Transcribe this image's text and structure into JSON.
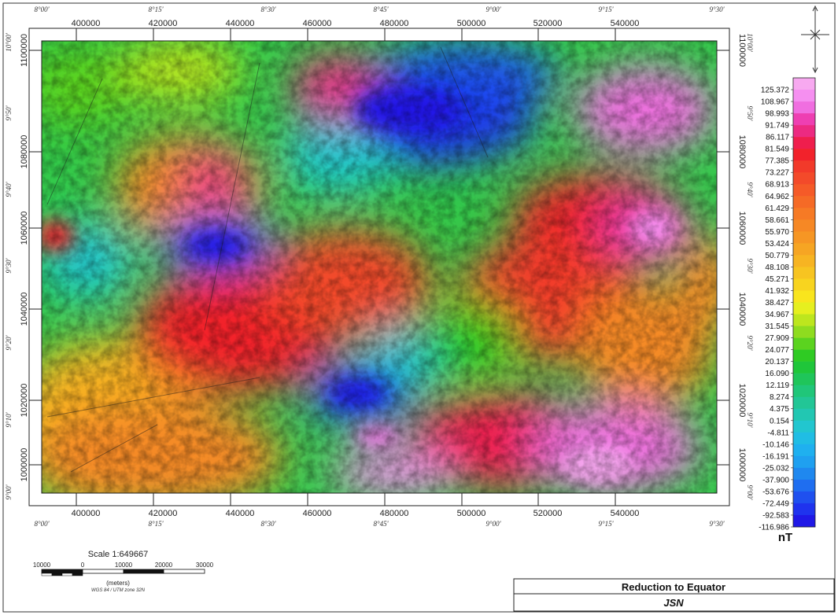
{
  "map": {
    "projected_x_ticks": [
      "400000",
      "420000",
      "440000",
      "460000",
      "480000",
      "500000",
      "520000",
      "540000"
    ],
    "projected_y_ticks": [
      "1100000",
      "1080000",
      "1060000",
      "1040000",
      "1020000",
      "1000000"
    ],
    "longitude_ticks": [
      "8°00'",
      "8°15'",
      "8°30'",
      "8°45'",
      "9°00'",
      "9°15'",
      "9°30'"
    ],
    "latitude_ticks": [
      "10°00'",
      "9°50'",
      "9°40'",
      "9°30'",
      "9°20'",
      "9°10'",
      "9°00'"
    ],
    "x_range_m": [
      389000,
      556000
    ],
    "y_range_m": [
      997000,
      1101000
    ]
  },
  "legend": {
    "values": [
      "125.372",
      "108.967",
      "98.993",
      "91.749",
      "86.117",
      "81.549",
      "77.385",
      "73.227",
      "68.913",
      "64.962",
      "61.429",
      "58.661",
      "55.970",
      "53.424",
      "50.779",
      "48.108",
      "45.271",
      "41.932",
      "38.427",
      "34.967",
      "31.545",
      "27.909",
      "24.077",
      "20.137",
      "16.090",
      "12.119",
      "8.274",
      "4.375",
      "0.154",
      "-4.811",
      "-10.146",
      "-16.191",
      "-25.032",
      "-37.900",
      "-53.676",
      "-72.449",
      "-92.583",
      "-116.986"
    ],
    "unit": "nT",
    "colors_top_to_bottom": [
      "#f7a9f0",
      "#f58ff0",
      "#f06ee0",
      "#ee3fb2",
      "#ec2a82",
      "#ef1e4d",
      "#f2222b",
      "#f23a2a",
      "#f34a2a",
      "#f55a28",
      "#f56a26",
      "#f67a25",
      "#f68825",
      "#f69624",
      "#f6a523",
      "#f7b422",
      "#f7c421",
      "#f8d41f",
      "#f9e51d",
      "#e6ef1f",
      "#bde61e",
      "#8fdc1f",
      "#5bd31f",
      "#2fcb23",
      "#1fc63a",
      "#1fc55a",
      "#20c679",
      "#22c696",
      "#22c7b2",
      "#22c6cf",
      "#20bde4",
      "#1fb0ef",
      "#1fa0f0",
      "#1f88ef",
      "#1f6ef0",
      "#1f50ef",
      "#1f33ee",
      "#2018e6"
    ]
  },
  "scale_bar": {
    "title": "Scale 1:649667",
    "ticks": [
      "10000",
      "0",
      "10000",
      "20000",
      "30000"
    ],
    "units": "(meters)",
    "datum": "WGS 84 / UTM zone 32N"
  },
  "title_block": {
    "title": "Reduction to Equator",
    "author": "JSN"
  },
  "north_arrow": {
    "icon": "north-arrow-icon"
  }
}
